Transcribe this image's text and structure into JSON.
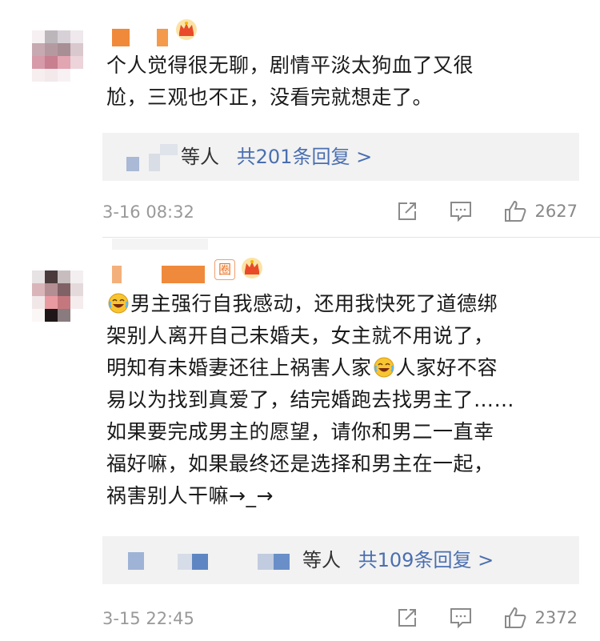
{
  "comments": [
    {
      "lines": [
        "个人觉得很无聊，剧情平淡太狗血了又很",
        "尬，三观也不正，没看完就想走了。"
      ],
      "reply_names": "等人",
      "reply_count": "共201条回复 >",
      "time": "3-16 08:32",
      "likes": "2627"
    },
    {
      "badge": "圈",
      "line1_a": "男主强行自我感动，还用我快死了道德绑",
      "lines": [
        "架别人离开自己未婚夫，女主就不用说了，"
      ],
      "line3_a": "明知有未婚妻还往上祸害人家",
      "line3_b": "人家好不容",
      "lines2": [
        "易以为找到真爱了，结完婚跑去找男主了……",
        "如果要完成男主的愿望，请你和男二一直幸",
        "福好嘛，如果最终还是选择和男主在一起，",
        "祸害别人干嘛→_→"
      ],
      "reply_names": "等人",
      "reply_count": "共109条回复 >",
      "time": "3-15 22:45",
      "likes": "2372"
    }
  ],
  "icons": {
    "share": "share-icon",
    "comment": "comment-icon",
    "like": "thumbs-up-icon",
    "crown": "crown-icon",
    "emoji": "laugh-cry-emoji-icon"
  },
  "colors": {
    "link_blue": "#4a6fb0",
    "meta_gray": "#999999",
    "reply_bg": "#f2f2f2",
    "accent_orange": "#e8701e"
  }
}
